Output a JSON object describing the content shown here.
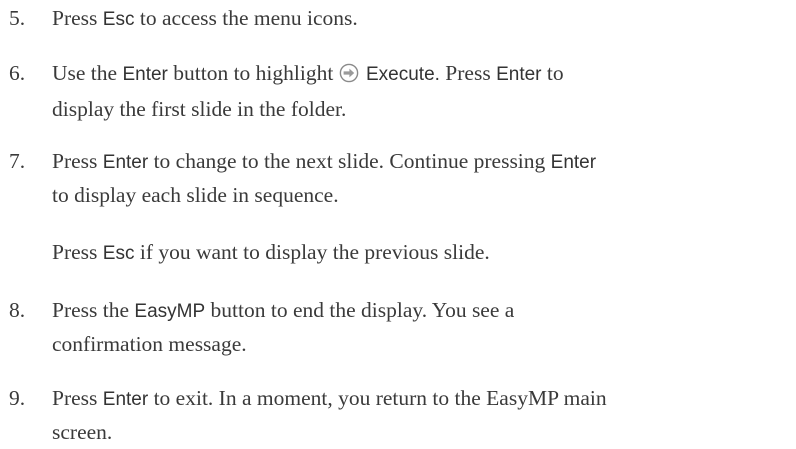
{
  "steps": [
    {
      "number": "5.",
      "lines": [
        [
          {
            "t": "Press "
          },
          {
            "t": "Esc",
            "ui": true
          },
          {
            "t": " to access the menu icons."
          }
        ]
      ]
    },
    {
      "number": "6.",
      "lines": [
        [
          {
            "t": "Use the "
          },
          {
            "t": "Enter",
            "ui": true
          },
          {
            "t": " button to highlight "
          },
          {
            "icon": "execute-arrow-icon"
          },
          {
            "t": " Execute.",
            "ui": true
          },
          {
            "t": " Press "
          },
          {
            "t": "Enter",
            "ui": true
          },
          {
            "t": " to"
          }
        ],
        [
          {
            "t": "display the first slide in the folder."
          }
        ]
      ]
    },
    {
      "number": "7.",
      "lines": [
        [
          {
            "t": "Press "
          },
          {
            "t": "Enter",
            "ui": true
          },
          {
            "t": " to change to the next slide. Continue pressing "
          },
          {
            "t": "Enter",
            "ui": true
          }
        ],
        [
          {
            "t": "to display each slide in sequence."
          }
        ]
      ]
    },
    {
      "number": "8.",
      "lines": [
        [
          {
            "t": "Press the "
          },
          {
            "t": "EasyMP",
            "ui": true
          },
          {
            "t": " button to end the display. You see a"
          }
        ],
        [
          {
            "t": "confirmation message."
          }
        ]
      ]
    },
    {
      "number": "9.",
      "lines": [
        [
          {
            "t": "Press "
          },
          {
            "t": "Enter",
            "ui": true
          },
          {
            "t": " to exit. In a moment, you return to the EasyMP main"
          }
        ],
        [
          {
            "t": "screen."
          }
        ]
      ]
    }
  ],
  "note": [
    {
      "t": "Press "
    },
    {
      "t": "Esc",
      "ui": true
    },
    {
      "t": " if you want to display the previous slide."
    }
  ]
}
